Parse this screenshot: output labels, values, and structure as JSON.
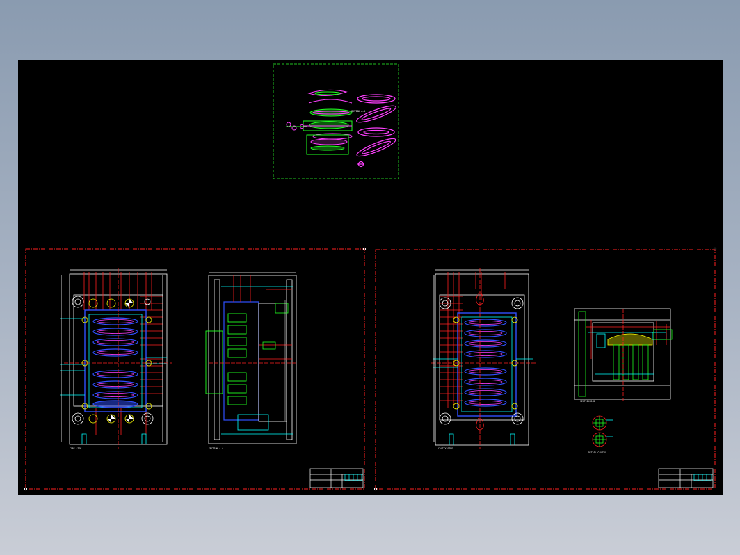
{
  "window": {
    "background_top": "#8a9bb0",
    "background_bottom": "#c9cdd6"
  },
  "canvas": {
    "background": "#000000"
  },
  "colors": {
    "frame_red": "#ff2020",
    "viewport_green": "#20c020",
    "cad_white": "#ffffff",
    "cad_cyan": "#00ffff",
    "cad_blue": "#3050ff",
    "cad_green": "#20ff20",
    "cad_magenta": "#ff40ff",
    "cad_yellow": "#ffff00"
  },
  "sheets": [
    {
      "name": "sheet-1",
      "plan_label": "CORE SIDE",
      "section_label": "SECTION A-A",
      "title_block": "title-block"
    },
    {
      "name": "sheet-2",
      "plan_label": "CAVITY SIDE",
      "section_label": "SECTION B-B",
      "detail_label": "DETAIL CAVITY"
    }
  ],
  "part_view": {
    "section_tag": "SECTION A-A"
  }
}
